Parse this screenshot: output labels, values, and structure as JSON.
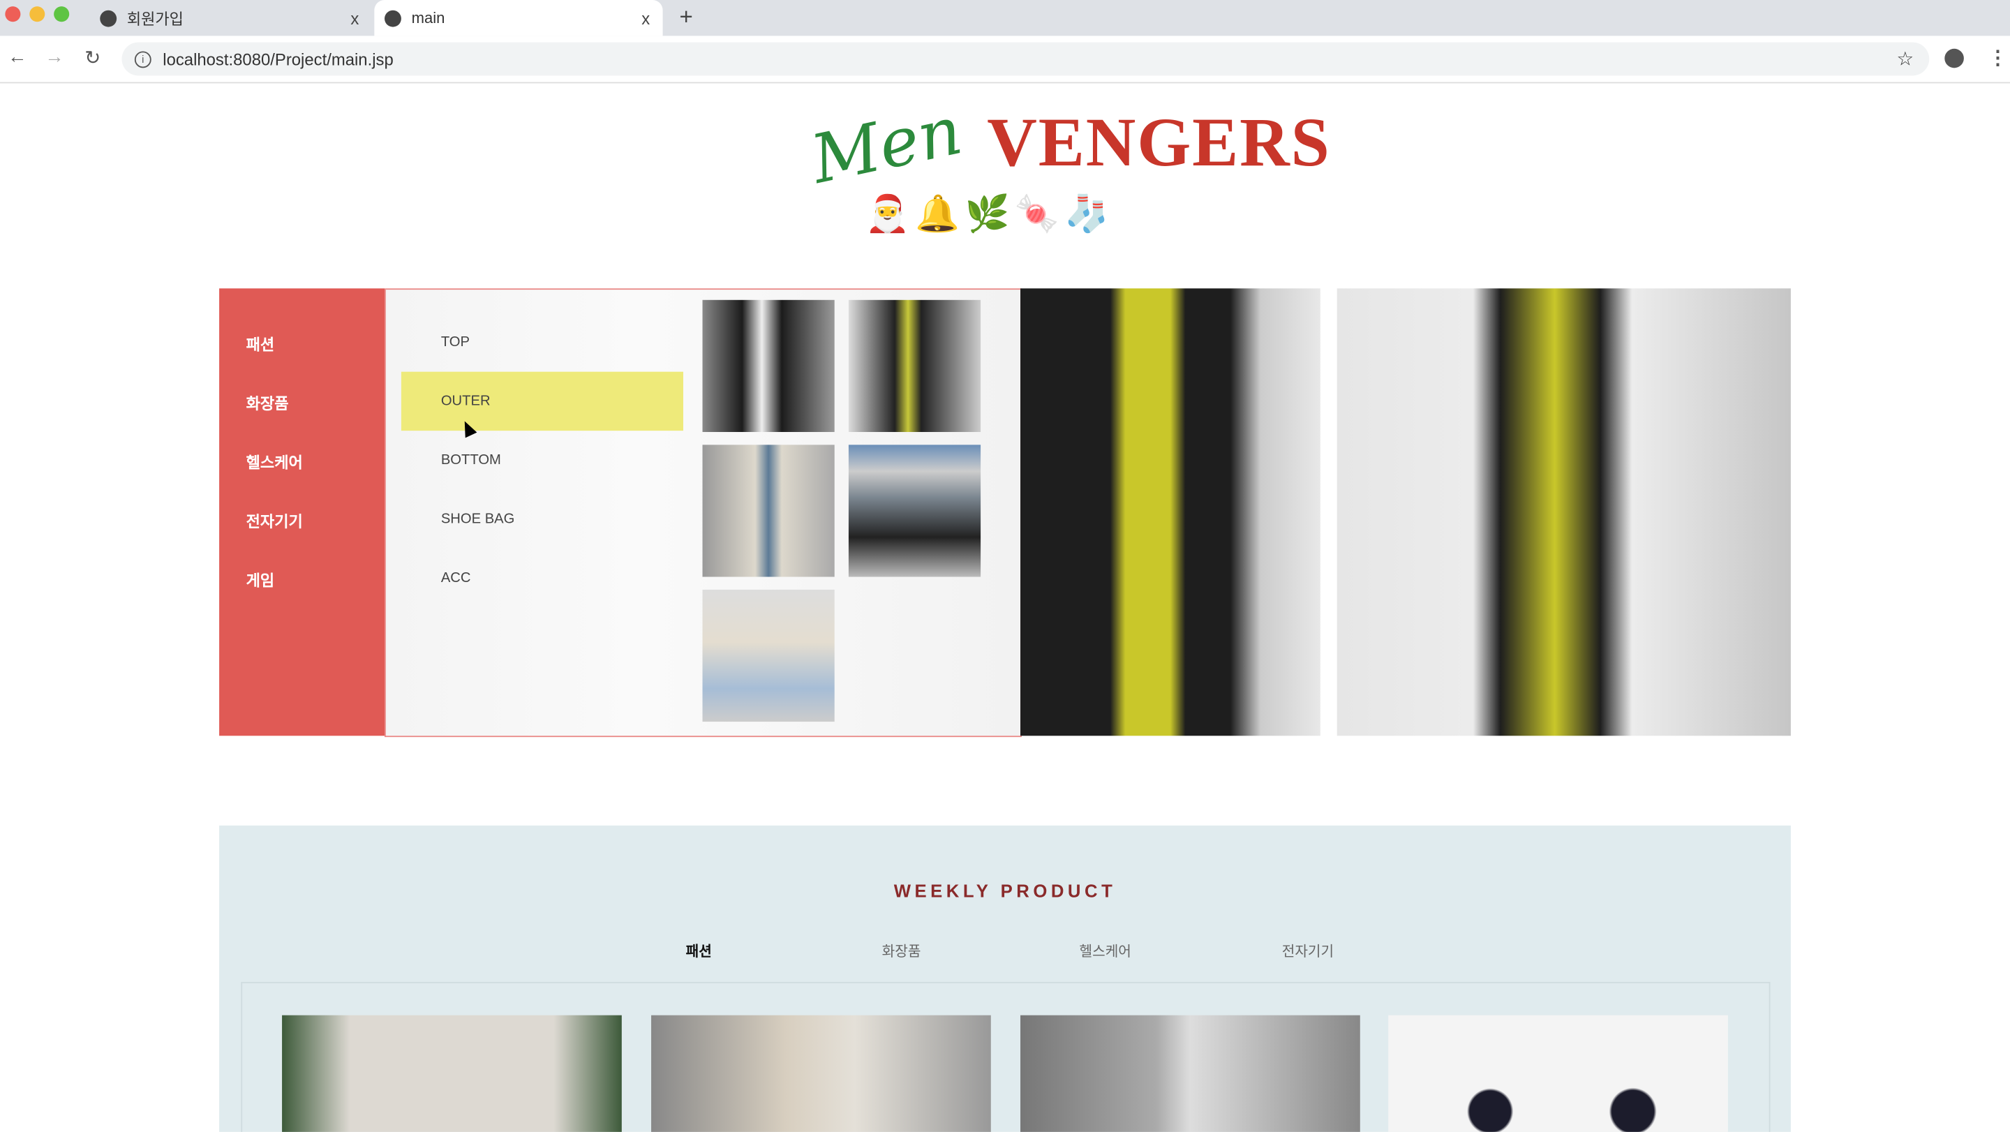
{
  "browser": {
    "tabs": [
      {
        "title": "회원가입",
        "close": "x",
        "active": false
      },
      {
        "title": "main",
        "close": "x",
        "active": true
      }
    ],
    "new_tab": "+",
    "url": "localhost:8080/Project/main.jsp",
    "icons": [
      "back-icon",
      "forward-icon",
      "reload-icon",
      "info-icon",
      "star-icon",
      "account-icon",
      "menu-icon"
    ]
  },
  "logo": {
    "text_a": "Men",
    "text_b": "VENGERS"
  },
  "categories": [
    {
      "label": "패션"
    },
    {
      "label": "화장품"
    },
    {
      "label": "헬스케어"
    },
    {
      "label": "전자기기"
    },
    {
      "label": "게임"
    }
  ],
  "subcategories": [
    {
      "label": "TOP"
    },
    {
      "label": "OUTER",
      "highlighted": true
    },
    {
      "label": "BOTTOM"
    },
    {
      "label": "SHOE BAG"
    },
    {
      "label": "ACC"
    }
  ],
  "weekly": {
    "title": "WEEKLY PRODUCT",
    "tabs": [
      {
        "label": "패션",
        "active": true
      },
      {
        "label": "화장품"
      },
      {
        "label": "헬스케어"
      },
      {
        "label": "전자기기"
      }
    ]
  },
  "colors": {
    "category_bg": "#e05a55",
    "highlight": "#eeea7a",
    "weekly_bg": "#e0ebee",
    "weekly_title": "#8a2a2a"
  }
}
